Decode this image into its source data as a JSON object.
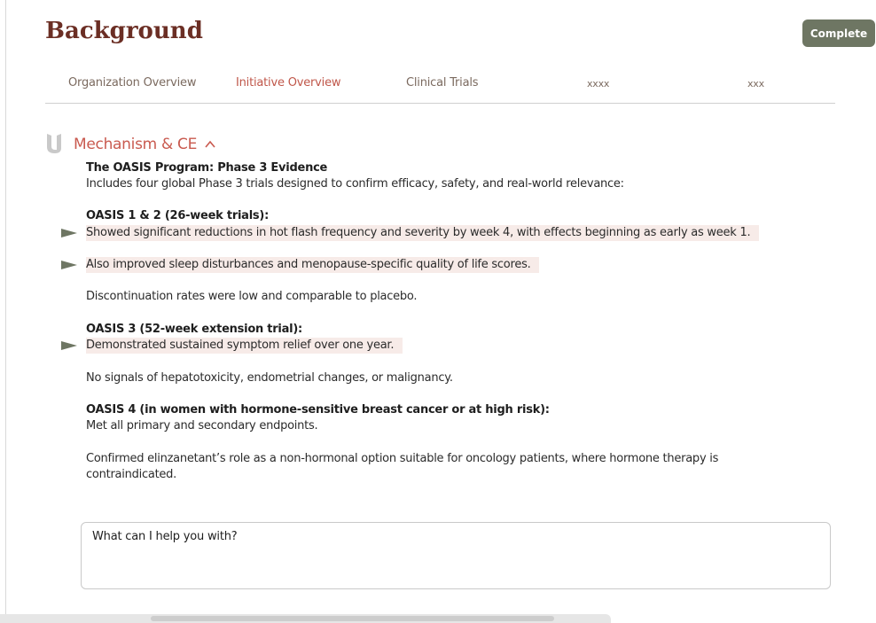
{
  "header": {
    "title": "Background",
    "complete_label": "Complete"
  },
  "tabs": [
    {
      "label": "Organization Overview",
      "active": false
    },
    {
      "label": "Initiative Overview",
      "active": true
    },
    {
      "label": "Clinical Trials",
      "active": false
    },
    {
      "label": "xxxx",
      "active": false
    },
    {
      "label": "xxx",
      "active": false
    }
  ],
  "section": {
    "title": "Mechanism & CE",
    "icon": "section-logo-icon",
    "toggle_icon": "chevron-up-icon"
  },
  "content": {
    "program_heading": "The OASIS Program: Phase 3 Evidence",
    "program_intro": "Includes four global Phase 3 trials designed to confirm efficacy, safety, and real-world relevance:",
    "oasis12_heading": "OASIS 1 & 2 (26-week trials):",
    "oasis12_point1": "Showed significant reductions in hot flash frequency and severity by week 4, with effects beginning as early as week 1.",
    "oasis12_point2": "Also improved sleep disturbances and menopause-specific quality of life scores.",
    "oasis12_note": "Discontinuation rates were low and comparable to placebo.",
    "oasis3_heading": "OASIS 3 (52-week extension trial):",
    "oasis3_point1": "Demonstrated sustained symptom relief over one year.",
    "oasis3_note": "No signals of hepatotoxicity, endometrial changes, or malignancy.",
    "oasis4_heading": "OASIS 4 (in women with hormone-sensitive breast cancer or at high risk):",
    "oasis4_line1": "Met all primary and secondary endpoints.",
    "oasis4_line2a": "Confirmed elinzanetant’s role as a non-hormonal option suitable for oncology patients, where hormone therapy is",
    "oasis4_line2b": "contraindicated."
  },
  "chat": {
    "placeholder": "What can I help you with?"
  },
  "colors": {
    "title": "#6b2e24",
    "accent": "#c95a4f",
    "button": "#6e7663",
    "highlight": "#f7ebe8",
    "arrow": "#6e7663"
  }
}
